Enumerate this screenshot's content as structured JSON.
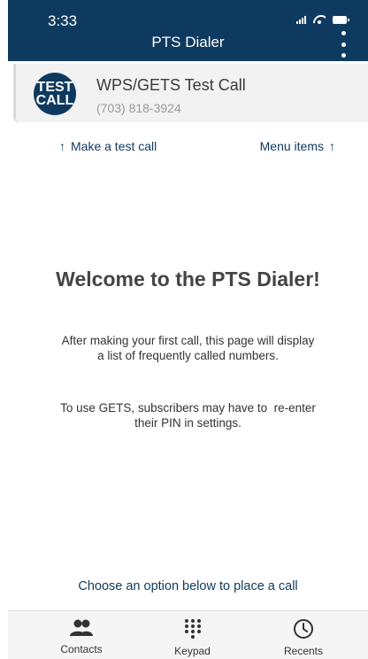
{
  "status_bar": {
    "time": "3:33"
  },
  "header": {
    "title": "PTS Dialer"
  },
  "test_call": {
    "badge_line1": "TEST",
    "badge_line2": "CALL",
    "name": "WPS/GETS Test Call",
    "number": "(703) 818-3924"
  },
  "hints": {
    "make_test_call": "Make a test call",
    "menu_items": "Menu items",
    "arrow": "↑"
  },
  "main": {
    "welcome": "Welcome to the PTS Dialer!",
    "para1_line1": "After making your first call, this page will display",
    "para1_line2": "a list of frequently called numbers.",
    "para2_line1": "To use GETS, subscribers may have to  re-enter",
    "para2_line2": "their PIN in settings.",
    "choose": "Choose an option below to place a call"
  },
  "tabs": [
    {
      "label": "Contacts",
      "icon": "contacts-icon"
    },
    {
      "label": "Keypad",
      "icon": "keypad-icon"
    },
    {
      "label": "Recents",
      "icon": "recents-icon"
    }
  ],
  "colors": {
    "brand": "#0e3a5f",
    "card_bg": "#f2f2f2",
    "tab_bg": "#f5f5f5"
  }
}
